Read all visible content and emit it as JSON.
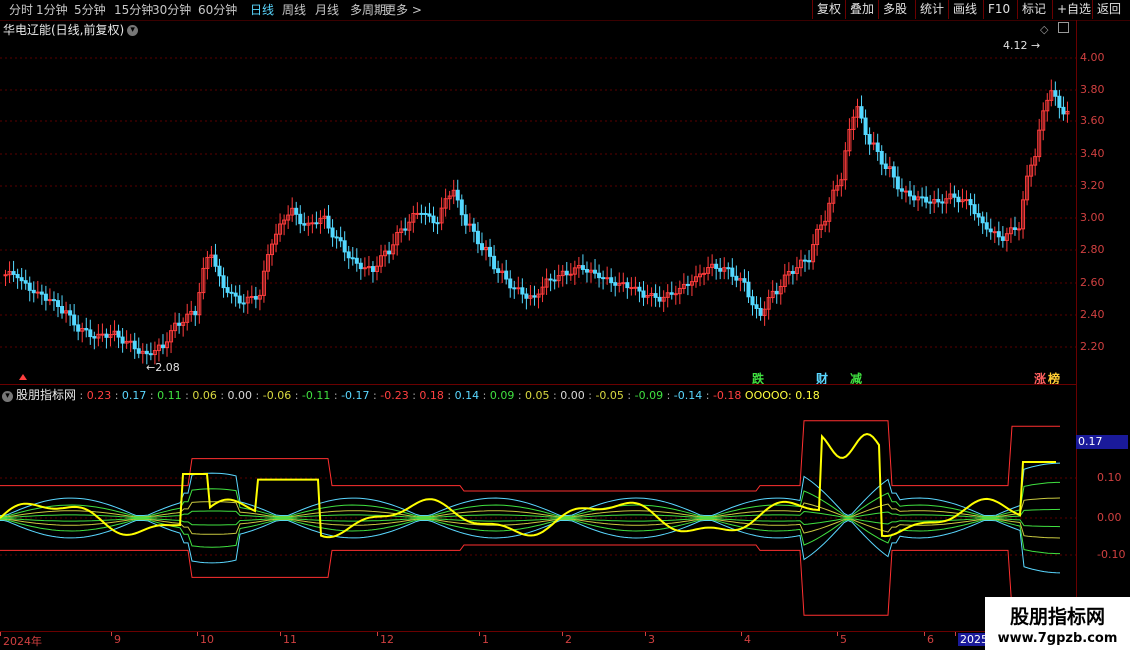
{
  "toolbar": {
    "periods": [
      "分时",
      "1分钟",
      "5分钟",
      "15分钟",
      "30分钟",
      "60分钟",
      "日线",
      "周线",
      "月线",
      "多周期",
      "更多 >"
    ],
    "active_period": "日线",
    "buttons": [
      "复权",
      "叠加",
      "多股",
      "统计",
      "画线",
      "F10",
      "标记",
      "+自选",
      "返回"
    ]
  },
  "main_chart": {
    "title": "华电辽能(日线,前复权)",
    "y_ticks": [
      "4.00",
      "3.80",
      "3.60",
      "3.40",
      "3.20",
      "3.00",
      "2.80",
      "2.60",
      "2.40",
      "2.20"
    ],
    "high_label": "4.12",
    "low_label": "2.08",
    "events": [
      {
        "text": "跌",
        "color": "#40e040"
      },
      {
        "text": "财",
        "color": "#5ad7ff"
      },
      {
        "text": "减",
        "color": "#40e040"
      },
      {
        "text": "涨",
        "color": "#ff6060"
      },
      {
        "text": "榜",
        "color": "#ffcc33"
      }
    ]
  },
  "indicator": {
    "name": "股朋指标网",
    "values": [
      {
        "v": "0.23",
        "c": "#ff4040"
      },
      {
        "v": "0.17",
        "c": "#5ad7ff"
      },
      {
        "v": "0.11",
        "c": "#40e040"
      },
      {
        "v": "0.06",
        "c": "#d8d840"
      },
      {
        "v": "0.00",
        "c": "#d8d8d8"
      },
      {
        "v": "-0.06",
        "c": "#d8d840"
      },
      {
        "v": "-0.11",
        "c": "#40e040"
      },
      {
        "v": "-0.17",
        "c": "#5ad7ff"
      },
      {
        "v": "-0.23",
        "c": "#ff4040"
      },
      {
        "v": "0.18",
        "c": "#ff4040"
      },
      {
        "v": "0.14",
        "c": "#5ad7ff"
      },
      {
        "v": "0.09",
        "c": "#40e040"
      },
      {
        "v": "0.05",
        "c": "#d8d840"
      },
      {
        "v": "0.00",
        "c": "#d8d8d8"
      },
      {
        "v": "-0.05",
        "c": "#d8d840"
      },
      {
        "v": "-0.09",
        "c": "#40e040"
      },
      {
        "v": "-0.14",
        "c": "#5ad7ff"
      },
      {
        "v": "-0.18",
        "c": "#ff4040"
      }
    ],
    "last_label": "OOOOO:",
    "last_value": "0.18",
    "y_ticks": [
      "0.10",
      "0.00",
      "-0.10"
    ],
    "current_marker": "0.17"
  },
  "date_axis": [
    "2024年",
    "9",
    "10",
    "11",
    "12",
    "1",
    "2",
    "3",
    "4",
    "5",
    "6",
    "2025"
  ],
  "watermark": {
    "line1": "股朋指标网",
    "line2": "www.7gpzb.com"
  },
  "colors": {
    "up": "#ff3c3c",
    "down": "#54d8ff",
    "grid": "#5a0000",
    "accent": "#ffff00"
  },
  "chart_data": {
    "type": "candlestick",
    "ylim": [
      2.08,
      4.12
    ],
    "closes": [
      2.65,
      2.55,
      2.5,
      2.42,
      2.3,
      2.26,
      2.28,
      2.22,
      2.15,
      2.2,
      2.35,
      2.42,
      2.8,
      2.55,
      2.48,
      2.52,
      2.9,
      3.05,
      2.95,
      3.0,
      2.85,
      2.72,
      2.68,
      2.8,
      2.95,
      3.05,
      2.98,
      3.18,
      2.95,
      2.8,
      2.65,
      2.55,
      2.5,
      2.62,
      2.66,
      2.7,
      2.65,
      2.6,
      2.58,
      2.52,
      2.5,
      2.55,
      2.62,
      2.7,
      2.68,
      2.6,
      2.4,
      2.55,
      2.68,
      2.75,
      3.0,
      3.25,
      3.7,
      3.45,
      3.3,
      3.15,
      3.12,
      3.1,
      3.14,
      3.1,
      2.95,
      2.88,
      2.95,
      3.4,
      3.8,
      3.65
    ]
  }
}
